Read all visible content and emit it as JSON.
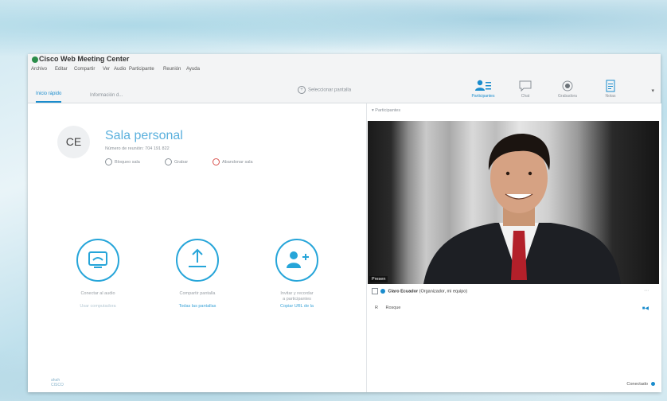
{
  "window": {
    "title": "Cisco Web Meeting Center",
    "menu": [
      "Archivo",
      "Editar",
      "Compartir",
      "Ver",
      "Audio",
      "Participante",
      "Reunión",
      "Ayuda"
    ]
  },
  "tabs": [
    {
      "label": "Inicio rápido",
      "active": true
    },
    {
      "label": "Información d...",
      "active": false
    }
  ],
  "toolbar": {
    "share_label": "Seleccionar pantalla",
    "panels": [
      {
        "label": "Participantes",
        "active": true
      },
      {
        "label": "Chat",
        "active": false
      },
      {
        "label": "Grabadora",
        "active": false
      },
      {
        "label": "Notas",
        "active": false
      }
    ]
  },
  "room": {
    "avatar_initials": "CE",
    "title": "Sala personal",
    "meeting_number": "Número de reunión: 704 191 822",
    "options": [
      "Bloqueo sala",
      "Grabar",
      "Abandonar sala"
    ]
  },
  "actions": [
    {
      "label": "Conectar al audio",
      "link": "Usar computadora"
    },
    {
      "label": "Compartir pantalla",
      "link": "Todas las pantallas"
    },
    {
      "label": "Invitar y recordar",
      "label2": "a participantes",
      "link": "Copiar URL de la"
    }
  ],
  "cisco_logo": {
    "line1": "ahah",
    "line2": "CISCO"
  },
  "participants": {
    "header": "Participantes",
    "video_tag": "Presen",
    "row1_name": "Claro Ecuador",
    "row1_role": "(Organizador, mi equipo)",
    "row2_initial": "R",
    "row2_name": "Rosque"
  },
  "status": {
    "connected_label": "Conectado"
  },
  "colors": {
    "accent": "#1a8ccd",
    "action_ring": "#26a5d9"
  }
}
